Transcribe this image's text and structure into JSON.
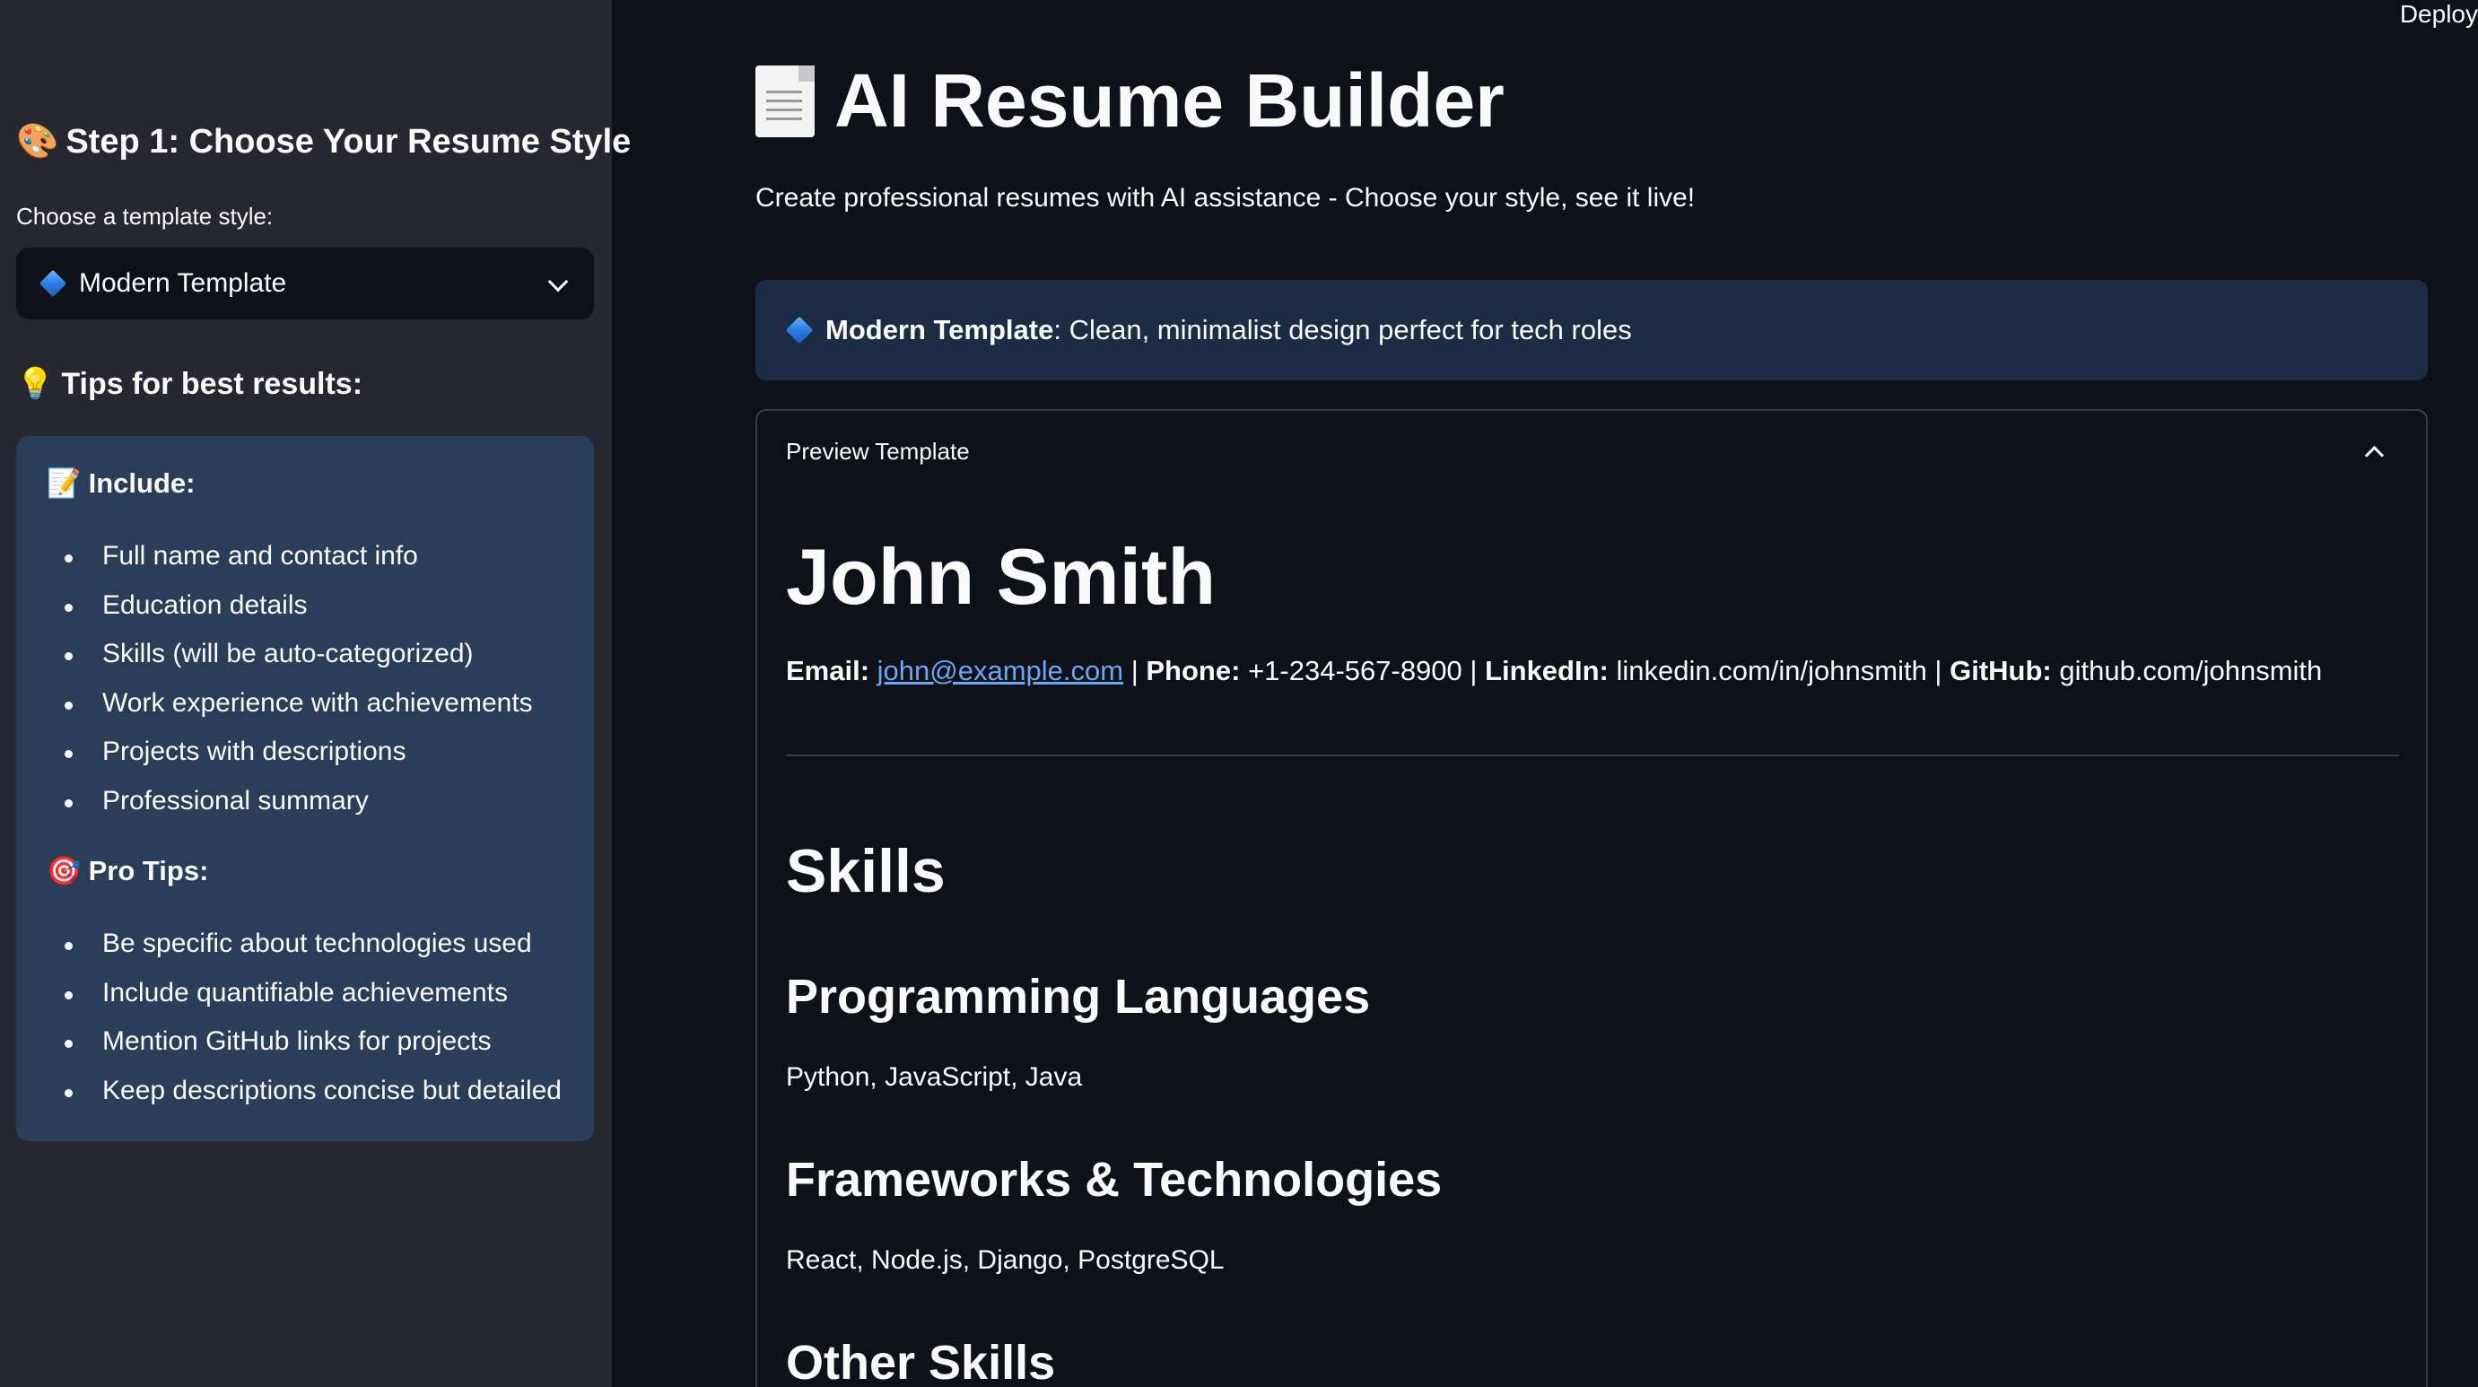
{
  "header": {
    "deploy_label": "Deploy"
  },
  "sidebar": {
    "step_heading": "Step 1: Choose Your Resume Style",
    "step_icon": "🎨",
    "template_label": "Choose a template style:",
    "template_selected": "Modern Template",
    "tips_heading": "Tips for best results:",
    "tips_icon": "💡",
    "include_heading": "Include:",
    "include_icon": "📝",
    "include_items": [
      "Full name and contact info",
      "Education details",
      "Skills (will be auto-categorized)",
      "Work experience with achievements",
      "Projects with descriptions",
      "Professional summary"
    ],
    "pro_heading": "Pro Tips:",
    "pro_icon": "🎯",
    "pro_items": [
      "Be specific about technologies used",
      "Include quantifiable achievements",
      "Mention GitHub links for projects",
      "Keep descriptions concise but detailed"
    ]
  },
  "main": {
    "title": "AI Resume Builder",
    "subtitle": "Create professional resumes with AI assistance - Choose your style, see it live!",
    "info": {
      "name": "Modern Template",
      "description": ": Clean, minimalist design perfect for tech roles"
    },
    "preview": {
      "header": "Preview Template",
      "name": "John Smith",
      "contact": {
        "email_label": "Email:",
        "email": "john@example.com",
        "phone_label": "Phone:",
        "phone": "+1-234-567-8900",
        "linkedin_label": "LinkedIn:",
        "linkedin": "linkedin.com/in/johnsmith",
        "github_label": "GitHub:",
        "github": "github.com/johnsmith",
        "separator": " | "
      },
      "skills_heading": "Skills",
      "sections": [
        {
          "heading": "Programming Languages",
          "text": "Python, JavaScript, Java"
        },
        {
          "heading": "Frameworks & Technologies",
          "text": "React, Node.js, Django, PostgreSQL"
        },
        {
          "heading": "Other Skills",
          "text": ""
        }
      ]
    }
  }
}
